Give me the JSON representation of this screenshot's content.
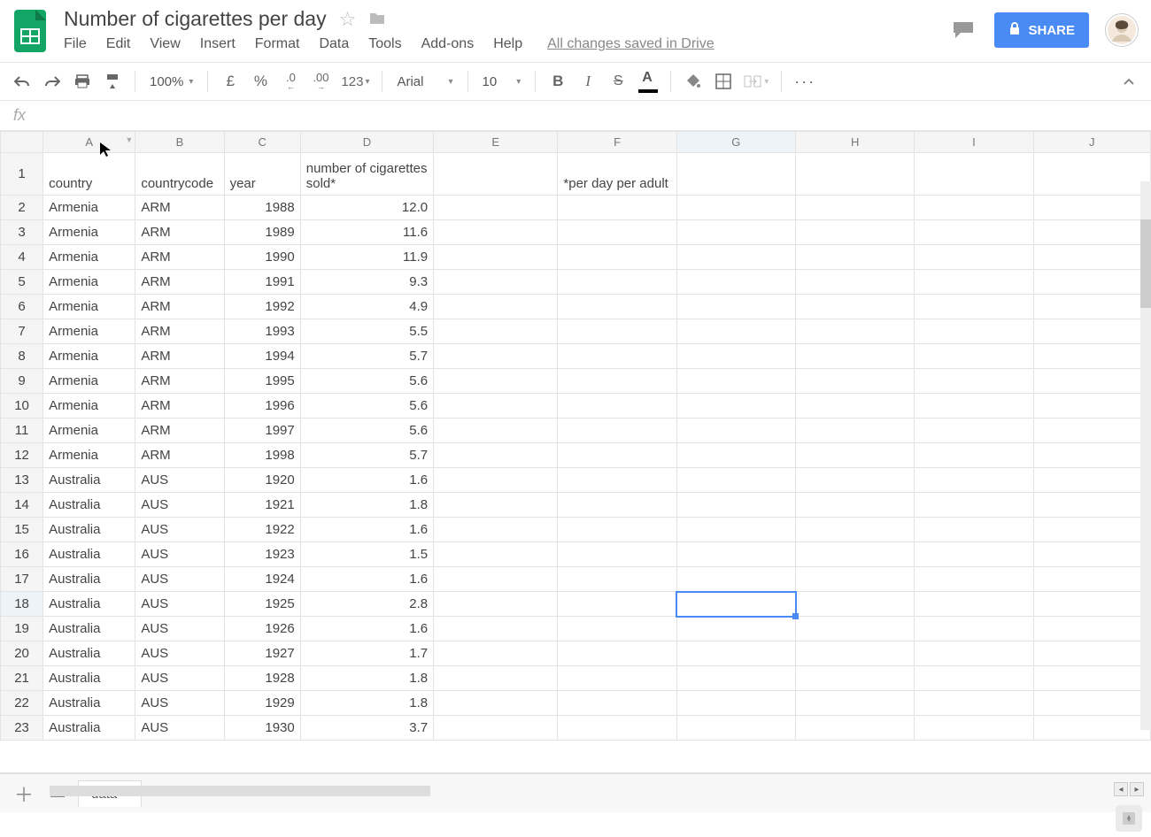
{
  "doc": {
    "title": "Number of cigarettes per day",
    "save_status": "All changes saved in Drive"
  },
  "menu": {
    "file": "File",
    "edit": "Edit",
    "view": "View",
    "insert": "Insert",
    "format": "Format",
    "data": "Data",
    "tools": "Tools",
    "addons": "Add-ons",
    "help": "Help"
  },
  "toolbar": {
    "zoom": "100%",
    "currency": "£",
    "percent": "%",
    "dec_less": ".0",
    "dec_more": ".00",
    "numfmt": "123",
    "font": "Arial",
    "font_size": "10",
    "more": "···"
  },
  "share": {
    "label": "SHARE"
  },
  "columns": [
    "A",
    "B",
    "C",
    "D",
    "E",
    "F",
    "G",
    "H",
    "I",
    "J"
  ],
  "header_row": {
    "A": "country",
    "B": "countrycode",
    "C": "year",
    "D": "number of cigarettes sold*",
    "E": "",
    "F": "*per day per adult",
    "G": "",
    "H": "",
    "I": "",
    "J": ""
  },
  "rows": [
    {
      "n": 2,
      "A": "Armenia",
      "B": "ARM",
      "C": "1988",
      "D": "12.0"
    },
    {
      "n": 3,
      "A": "Armenia",
      "B": "ARM",
      "C": "1989",
      "D": "11.6"
    },
    {
      "n": 4,
      "A": "Armenia",
      "B": "ARM",
      "C": "1990",
      "D": "11.9"
    },
    {
      "n": 5,
      "A": "Armenia",
      "B": "ARM",
      "C": "1991",
      "D": "9.3"
    },
    {
      "n": 6,
      "A": "Armenia",
      "B": "ARM",
      "C": "1992",
      "D": "4.9"
    },
    {
      "n": 7,
      "A": "Armenia",
      "B": "ARM",
      "C": "1993",
      "D": "5.5"
    },
    {
      "n": 8,
      "A": "Armenia",
      "B": "ARM",
      "C": "1994",
      "D": "5.7"
    },
    {
      "n": 9,
      "A": "Armenia",
      "B": "ARM",
      "C": "1995",
      "D": "5.6"
    },
    {
      "n": 10,
      "A": "Armenia",
      "B": "ARM",
      "C": "1996",
      "D": "5.6"
    },
    {
      "n": 11,
      "A": "Armenia",
      "B": "ARM",
      "C": "1997",
      "D": "5.6"
    },
    {
      "n": 12,
      "A": "Armenia",
      "B": "ARM",
      "C": "1998",
      "D": "5.7"
    },
    {
      "n": 13,
      "A": "Australia",
      "B": "AUS",
      "C": "1920",
      "D": "1.6"
    },
    {
      "n": 14,
      "A": "Australia",
      "B": "AUS",
      "C": "1921",
      "D": "1.8"
    },
    {
      "n": 15,
      "A": "Australia",
      "B": "AUS",
      "C": "1922",
      "D": "1.6"
    },
    {
      "n": 16,
      "A": "Australia",
      "B": "AUS",
      "C": "1923",
      "D": "1.5"
    },
    {
      "n": 17,
      "A": "Australia",
      "B": "AUS",
      "C": "1924",
      "D": "1.6"
    },
    {
      "n": 18,
      "A": "Australia",
      "B": "AUS",
      "C": "1925",
      "D": "2.8"
    },
    {
      "n": 19,
      "A": "Australia",
      "B": "AUS",
      "C": "1926",
      "D": "1.6"
    },
    {
      "n": 20,
      "A": "Australia",
      "B": "AUS",
      "C": "1927",
      "D": "1.7"
    },
    {
      "n": 21,
      "A": "Australia",
      "B": "AUS",
      "C": "1928",
      "D": "1.8"
    },
    {
      "n": 22,
      "A": "Australia",
      "B": "AUS",
      "C": "1929",
      "D": "1.8"
    },
    {
      "n": 23,
      "A": "Australia",
      "B": "AUS",
      "C": "1930",
      "D": "3.7"
    }
  ],
  "active_cell": {
    "row": 18,
    "col": "G"
  },
  "sheet_tab": {
    "name": "data"
  },
  "col_widths": {
    "row": 48,
    "A": 104,
    "B": 100,
    "C": 86,
    "D": 150,
    "E": 140,
    "F": 134,
    "G": 134,
    "H": 134,
    "I": 134,
    "J": 132
  }
}
